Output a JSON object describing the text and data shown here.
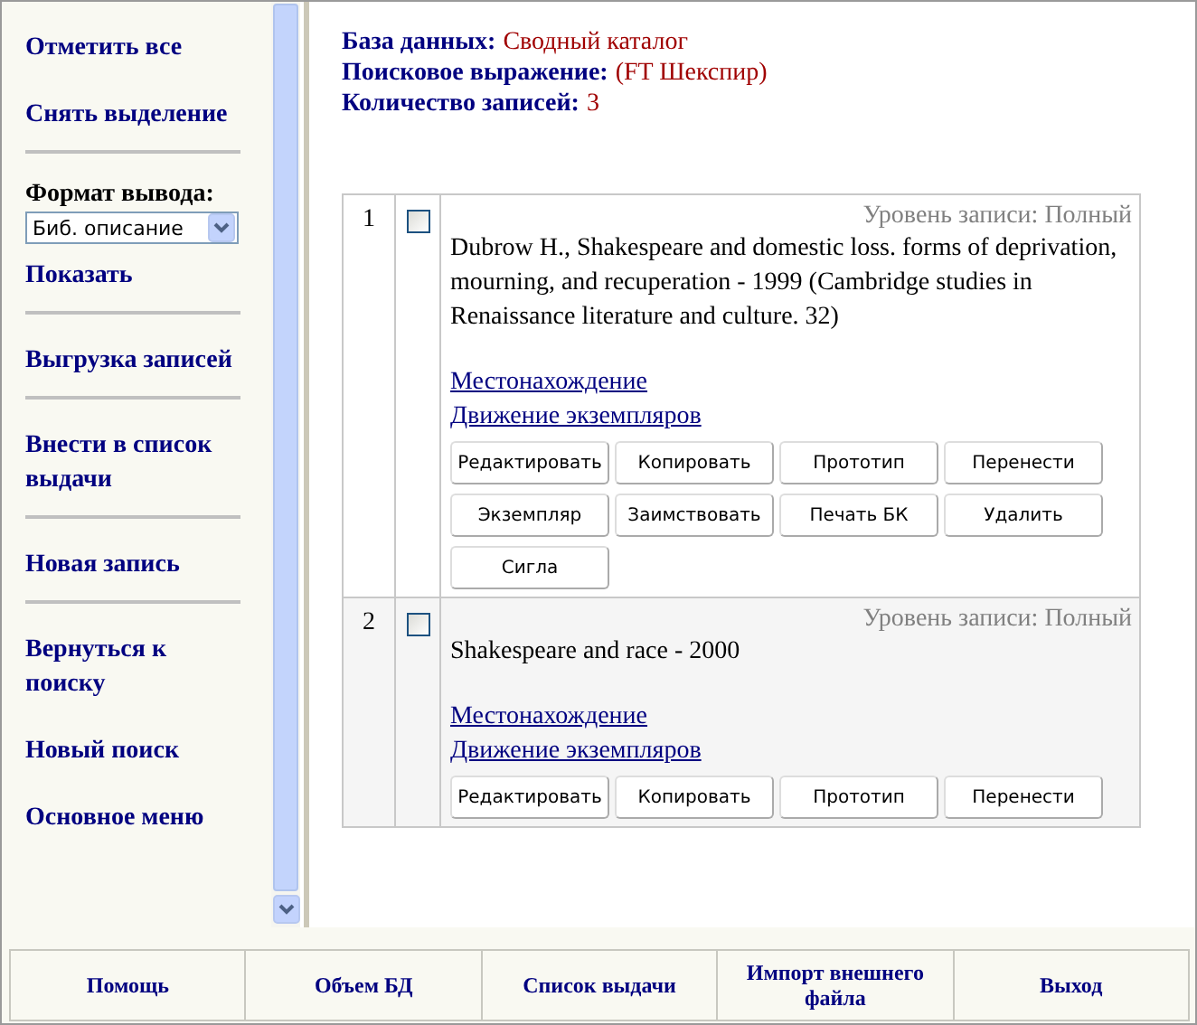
{
  "sidebar": {
    "items": [
      {
        "kind": "link",
        "label": "Отметить все"
      },
      {
        "kind": "link",
        "label": "Снять выделение"
      },
      {
        "kind": "divider"
      },
      {
        "kind": "format",
        "label": "Формат вывода:",
        "value": "Биб. описание"
      },
      {
        "kind": "link",
        "label": "Показать"
      },
      {
        "kind": "divider"
      },
      {
        "kind": "link",
        "label": "Выгрузка записей"
      },
      {
        "kind": "divider"
      },
      {
        "kind": "link",
        "label": "Внести в список выдачи"
      },
      {
        "kind": "divider"
      },
      {
        "kind": "link",
        "label": "Новая запись"
      },
      {
        "kind": "divider"
      },
      {
        "kind": "link",
        "label": "Вернуться к поиску"
      },
      {
        "kind": "link",
        "label": "Новый поиск"
      },
      {
        "kind": "link",
        "label": "Основное меню"
      }
    ]
  },
  "summary": [
    {
      "label": "База данных:",
      "value": "Сводный каталог"
    },
    {
      "label": "Поисковое выражение:",
      "value": "(FT Шекспир)"
    },
    {
      "label": "Количество записей:",
      "value": "3"
    }
  ],
  "records": [
    {
      "number": "1",
      "checked": false,
      "level": "Уровень записи: Полный",
      "description": "Dubrow H., Shakespeare and domestic loss. forms of deprivation, mourning, and recuperation - 1999 (Cambridge studies in Renaissance literature and culture. 32)",
      "links": [
        "Местонахождение",
        "Движение экземпляров"
      ],
      "buttons": [
        "Редактировать",
        "Копировать",
        "Прототип",
        "Перенести",
        "Экземпляр",
        "Заимствовать",
        "Печать БК",
        "Удалить",
        "Сигла"
      ]
    },
    {
      "number": "2",
      "checked": false,
      "level": "Уровень записи: Полный",
      "description": "Shakespeare and race - 2000",
      "links": [
        "Местонахождение",
        "Движение экземпляров"
      ],
      "buttons": [
        "Редактировать",
        "Копировать",
        "Прототип",
        "Перенести"
      ]
    }
  ],
  "footer": [
    "Помощь",
    "Объем БД",
    "Список выдачи",
    "Импорт внешнего файла",
    "Выход"
  ]
}
